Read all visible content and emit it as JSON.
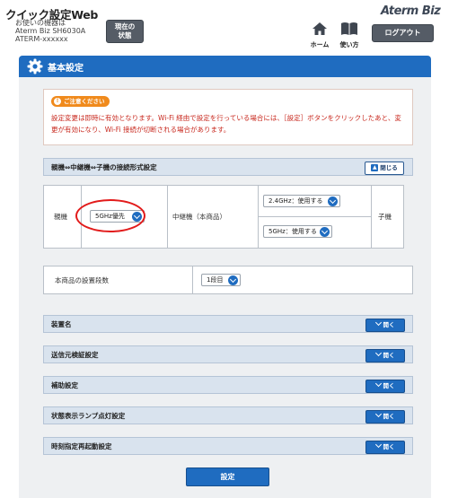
{
  "header": {
    "app_title": "クイック設定Web",
    "device_label": "お使いの機器は",
    "device_model": "Aterm Biz SH6030A",
    "device_name": "ATERM-xxxxxx",
    "status_button_line1": "現在の",
    "status_button_line2": "状態",
    "brand": "Aterm Biz",
    "home_label": "ホーム",
    "manual_label": "使い方",
    "logout_label": "ログアウト"
  },
  "section": {
    "title": "基本設定"
  },
  "notice": {
    "badge": "ご注意ください",
    "text": "設定変更は即時に有効となります。Wi-Fi 経由で設定を行っている場合には、［設定］ボタンをクリックしたあと、変更が有効になり、Wi-Fi 接続が切断される場合があります。"
  },
  "connection_panel": {
    "title": "親機⇔中継機⇔子機の接続形式設定",
    "close_label": "閉じる",
    "parent_label": "親機",
    "parent_select": "5GHz優先",
    "relay_label": "中継機（本商品）",
    "band_24": "2.4GHz：使用する",
    "band_5": "5GHz：使用する",
    "child_label": "子機"
  },
  "stage": {
    "label": "本商品の設置段数",
    "value": "1段目"
  },
  "panels": [
    {
      "title": "装置名",
      "button": "開く"
    },
    {
      "title": "送信元検証設定",
      "button": "開く"
    },
    {
      "title": "補助設定",
      "button": "開く"
    },
    {
      "title": "状態表示ランプ点灯設定",
      "button": "開く"
    },
    {
      "title": "時刻指定再起動設定",
      "button": "開く"
    }
  ],
  "submit_label": "設定",
  "icons": {
    "home": "home-icon",
    "manual": "book-icon",
    "section": "gear-icon",
    "notice": "exclamation-icon",
    "dropdown": "chevron-down-icon",
    "close": "chevron-up-icon"
  },
  "colors": {
    "accent": "#1f6cc0",
    "warning_text": "#c8281e",
    "badge": "#f08a1c",
    "annotation": "#e21b1b"
  }
}
